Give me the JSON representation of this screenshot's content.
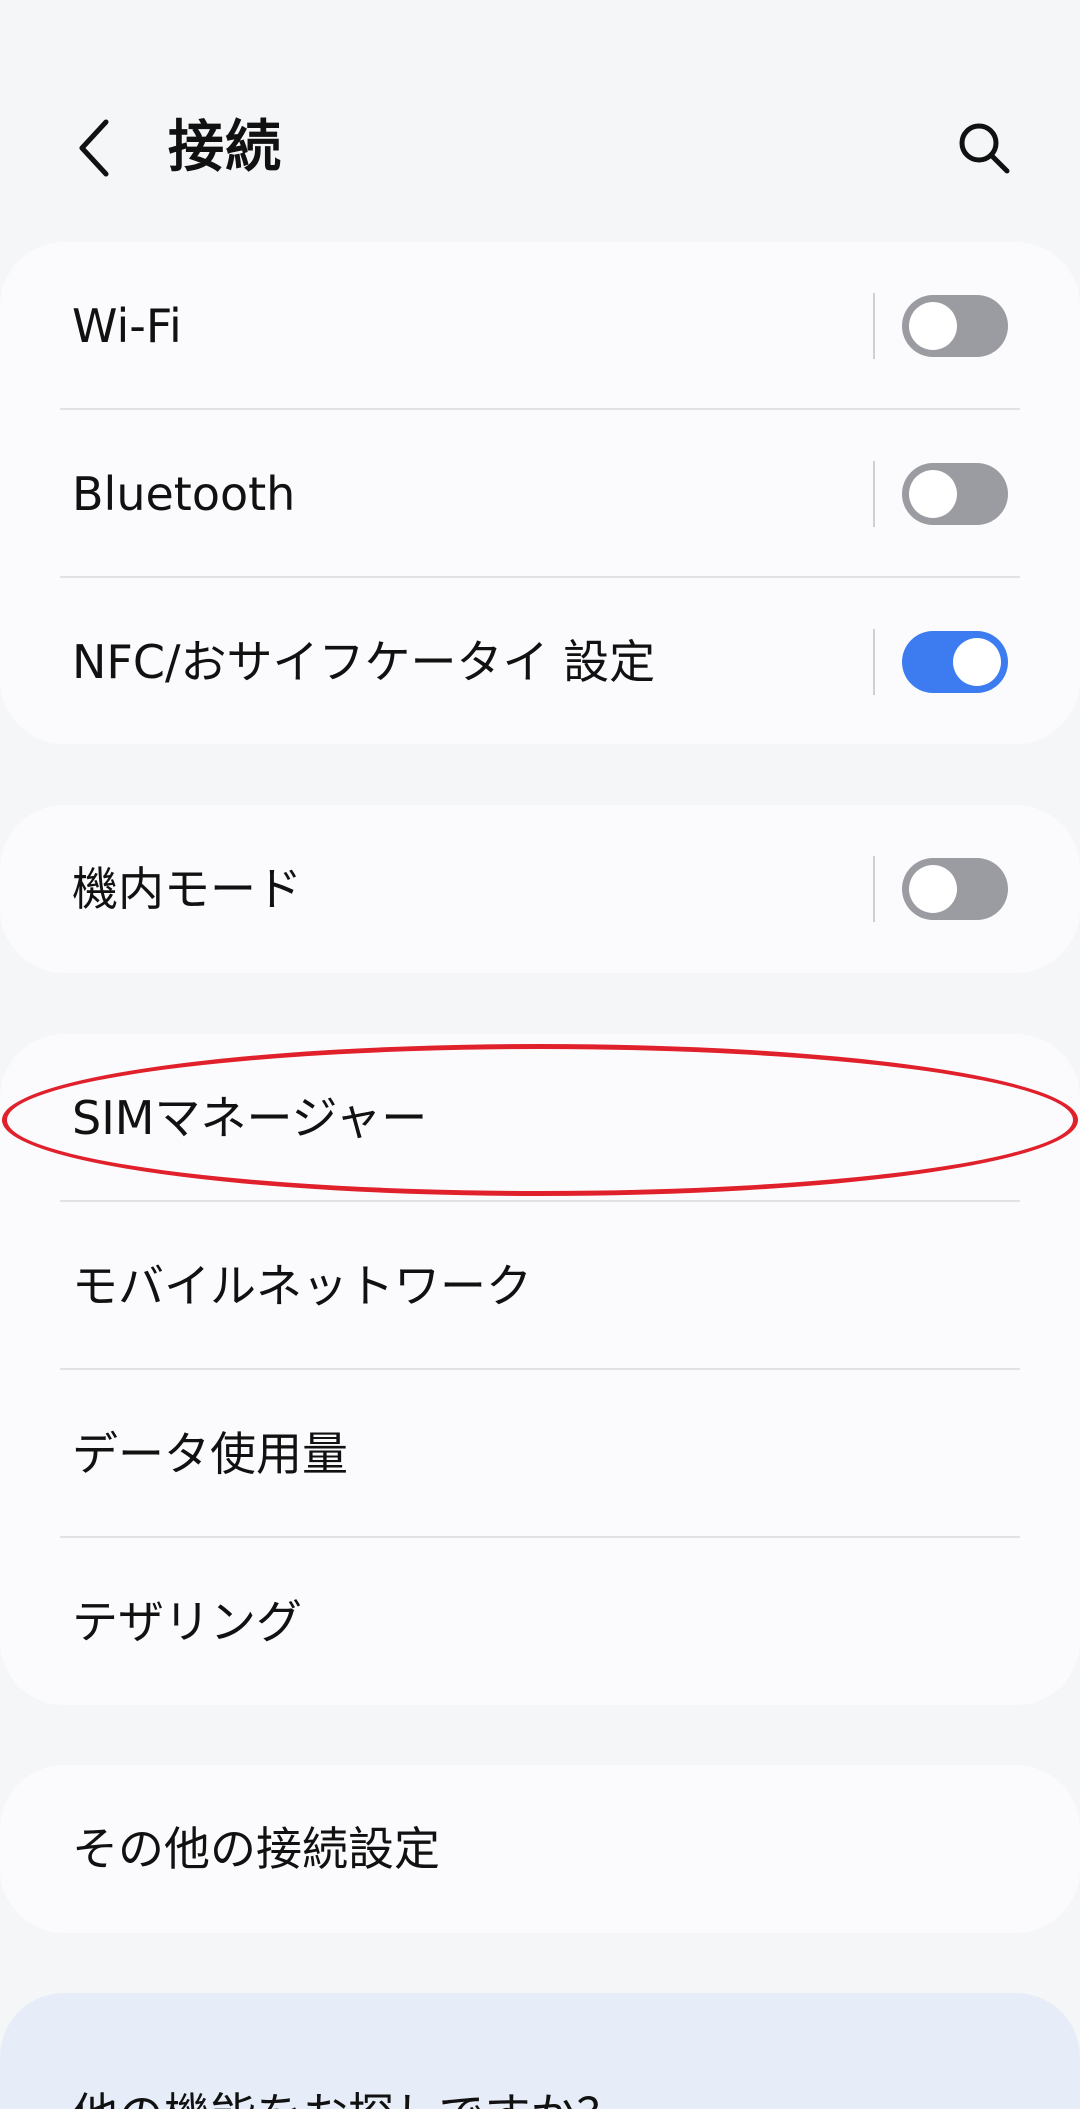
{
  "header": {
    "title": "接続",
    "back_icon": "chevron-left-icon",
    "search_icon": "search-icon"
  },
  "groups": {
    "main": [
      {
        "label": "Wi-Fi",
        "toggle": "off"
      },
      {
        "label": "Bluetooth",
        "toggle": "off"
      },
      {
        "label": "NFC/おサイフケータイ 設定",
        "toggle": "on"
      }
    ],
    "airplane": {
      "label": "機内モード",
      "toggle": "off"
    },
    "network": [
      {
        "label": "SIMマネージャー"
      },
      {
        "label": "モバイルネットワーク"
      },
      {
        "label": "データ使用量"
      },
      {
        "label": "テザリング"
      }
    ],
    "more": {
      "label": "その他の接続設定"
    },
    "suggestion": {
      "label": "他の機能をお探しですか？"
    }
  },
  "colors": {
    "background": "#f5f6f8",
    "card": "#fbfbfd",
    "toggle_on": "#3d7cf0",
    "toggle_off": "#9b9ca1",
    "highlight": "#e0202a",
    "suggestion_card": "#e7edf8"
  }
}
